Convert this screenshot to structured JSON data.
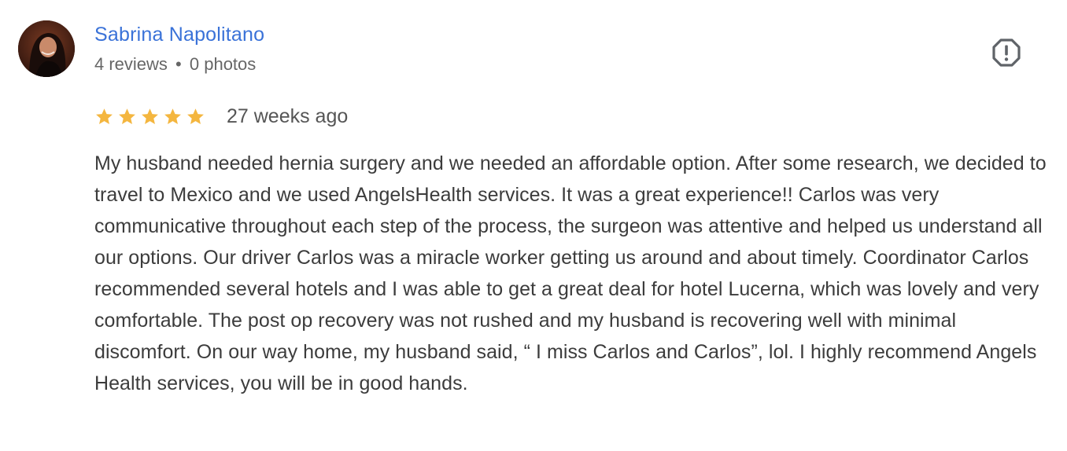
{
  "reviewer": {
    "name": "Sabrina Napolitano",
    "reviews_count": "4 reviews",
    "separator": "•",
    "photos_count": "0 photos",
    "avatar_icon": "user-photo"
  },
  "flag": {
    "icon": "report-flag-icon"
  },
  "rating": {
    "stars": 5,
    "max_stars": 5,
    "star_color": "#f4b63f",
    "time_ago": "27 weeks ago"
  },
  "review": {
    "text": "My husband needed hernia surgery and we needed an affordable option. After some research, we decided to travel to Mexico and we used AngelsHealth services. It was a great experience!! Carlos was very communicative throughout each step of the process, the surgeon was attentive and helped us understand all our options. Our driver Carlos was a miracle worker getting us around and about timely. Coordinator Carlos recommended several hotels and I was able to get a great deal for hotel Lucerna, which was lovely and very comfortable. The post op recovery was not rushed and my husband is recovering well with minimal discomfort. On our way home, my husband said, “ I miss Carlos and Carlos”, lol. I highly recommend Angels Health services, you will be in good hands."
  },
  "colors": {
    "name_link": "#3a72d8",
    "meta_text": "#666666",
    "body_text": "#3c3c3c",
    "icon_gray": "#5f6368"
  }
}
